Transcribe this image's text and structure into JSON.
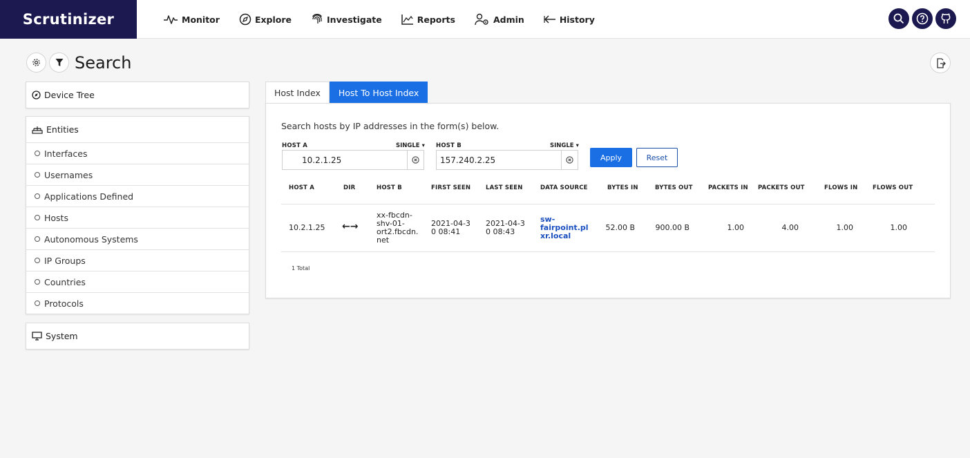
{
  "app": {
    "brand": "Scrutinizer"
  },
  "nav": [
    {
      "label": "Monitor",
      "icon": "pulse-icon"
    },
    {
      "label": "Explore",
      "icon": "compass-icon"
    },
    {
      "label": "Investigate",
      "icon": "fingerprint-icon"
    },
    {
      "label": "Reports",
      "icon": "chart-icon"
    },
    {
      "label": "Admin",
      "icon": "users-gear-icon"
    },
    {
      "label": "History",
      "icon": "arrow-left-icon"
    }
  ],
  "top_icons": [
    "search-icon",
    "help-icon",
    "github-icon"
  ],
  "page": {
    "title": "Search"
  },
  "sidebar": {
    "device_tree": "Device Tree",
    "entities": {
      "label": "Entities",
      "items": [
        "Interfaces",
        "Usernames",
        "Applications Defined",
        "Hosts",
        "Autonomous Systems",
        "IP Groups",
        "Countries",
        "Protocols"
      ]
    },
    "system": "System"
  },
  "tabs": [
    "Host Index",
    "Host To Host Index"
  ],
  "form": {
    "intro": "Search hosts by IP addresses in the form(s) below.",
    "host_a": {
      "label": "HOST A",
      "mode": "SINGLE",
      "value": "10.2.1.25"
    },
    "host_b": {
      "label": "HOST B",
      "mode": "SINGLE",
      "value": "157.240.2.25"
    },
    "apply": "Apply",
    "reset": "Reset"
  },
  "table": {
    "headers": [
      "HOST A",
      "DIR",
      "HOST B",
      "FIRST SEEN",
      "LAST SEEN",
      "DATA SOURCE",
      "BYTES IN",
      "BYTES OUT",
      "PACKETS IN",
      "PACKETS OUT",
      "FLOWS IN",
      "FLOWS OUT"
    ],
    "row": {
      "host_a": "10.2.1.25",
      "dir": "←→",
      "host_b": [
        "xx-fbcdn-",
        "shv-01-",
        "ort2.fbcdn.",
        "net"
      ],
      "first_seen": [
        "2021-04-3",
        "0 08:41"
      ],
      "last_seen": [
        "2021-04-3",
        "0 08:43"
      ],
      "data_source": [
        "sw-",
        "fairpoint.pl",
        "xr.local"
      ],
      "bytes_in": "52.00 B",
      "bytes_out": "900.00 B",
      "packets_in": "1.00",
      "packets_out": "4.00",
      "flows_in": "1.00",
      "flows_out": "1.00"
    },
    "total": "1 Total"
  }
}
